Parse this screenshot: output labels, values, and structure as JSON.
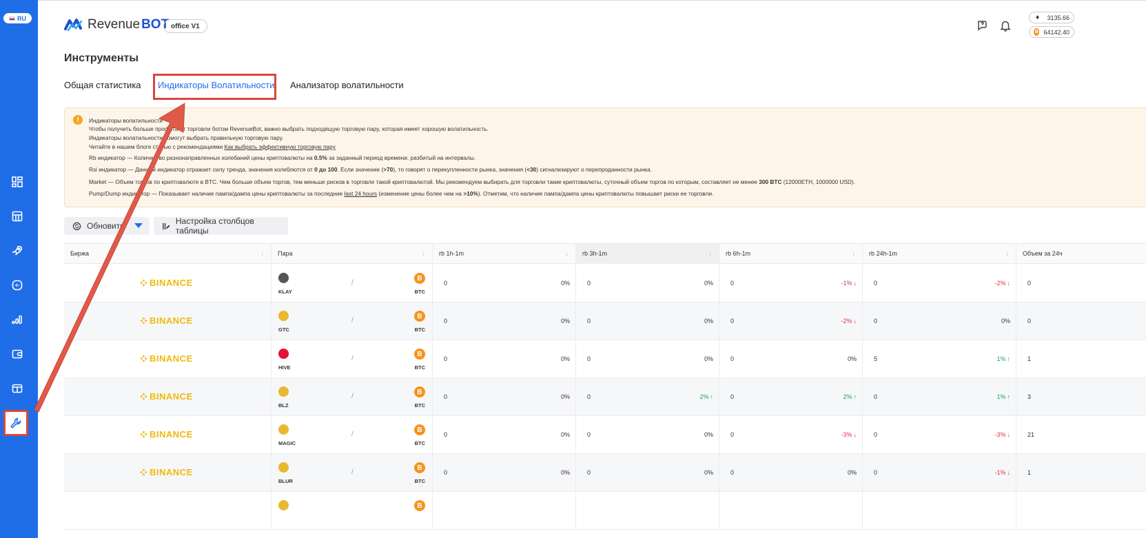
{
  "language": "RU",
  "logo": {
    "part1": "Revenue",
    "part2": "BOT"
  },
  "office_badge": "office V1",
  "balances": [
    {
      "coin_icon": "eth-icon",
      "value": "3135.66"
    },
    {
      "coin_icon": "btc-icon",
      "value": "64142.40"
    }
  ],
  "page_title": "Инструменты",
  "tabs": [
    {
      "label": "Общая статистика"
    },
    {
      "label": "Индикаторы Волатильности"
    },
    {
      "label": "Анализатор волатильности"
    }
  ],
  "notice": {
    "line1": "Индикаторы волатильности",
    "line2": "Чтобы получить больше профита от торговли ботом RevenueBot, важно выбрать подходящую торговую пару, которая имеет хорошую волатильность.",
    "line3": "Индикаторы волатильности помогут выбрать правильную торговую пару.",
    "line4_text": "Читайте в нашем блоге статью с рекомендациями ",
    "line4_link": "Как выбрать эффективную торговую пару",
    "rb_pre": "Rb индикатор — Количество разнонаправленных колебаний цены криптовалюты на ",
    "rb_bold": "0.5%",
    "rb_post": " за заданный период времени, разбитый на интервалы.",
    "rsi_pre": "Rsi индикатор — Данный индикатор отражает силу тренда, значения колеблются от ",
    "rsi_bold1": "0 до 100",
    "rsi_mid1": ". Если значение (",
    "rsi_bold2": ">70",
    "rsi_mid2": "), то говорят о перекупленности рынка, значения (",
    "rsi_bold3": "<30",
    "rsi_post": ") сигнализируют о перепроданности рынка.",
    "market_pre": "Market — Объем торгов по криптовалюте в BTC. Чем больше объем торгов, тем меньше рисков в торговле такой криптовалютой. Мы рекомендуем выбирать для торговли такие криптовалюты, суточный объем торгов по которым, составляет не менее ",
    "market_bold": "300 BTC",
    "market_post": " (12000ETH, 1000000 USD).",
    "pump_pre": "Pump/Dump индикатор — Показывает наличие пампа/дампа цены криптовалюты за последние ",
    "pump_link": "last 24 hours",
    "pump_mid": " (изменение цены более чем на ",
    "pump_bold": ">10%",
    "pump_post": "). Отметим, что наличие пампа/дампа цены криптовалюты повышает риски ее торговли."
  },
  "toolbar": {
    "refresh_label": "Обновить",
    "columns_label": "Настройка столбцов таблицы"
  },
  "table": {
    "columns": [
      "Биржа",
      "Пара",
      "rb 1h-1m",
      "rb 3h-1m",
      "rb 6h-1m",
      "rb 24h-1m",
      "Объем за 24ч"
    ],
    "quote_symbol": "BTC",
    "exchange": "BINANCE",
    "rows": [
      {
        "coin": "KLAY",
        "coin_color": "#555555",
        "rb1": "0",
        "rb1p": "0%",
        "rb1d": "",
        "rb3": "0",
        "rb3p": "0%",
        "rb3d": "",
        "rb6": "0",
        "rb6p": "-1%",
        "rb6d": "down",
        "rb24": "0",
        "rb24p": "-2%",
        "rb24d": "down",
        "vol": "0"
      },
      {
        "coin": "GTC",
        "coin_color": "#e8b830",
        "rb1": "0",
        "rb1p": "0%",
        "rb1d": "",
        "rb3": "0",
        "rb3p": "0%",
        "rb3d": "",
        "rb6": "0",
        "rb6p": "-2%",
        "rb6d": "down",
        "rb24": "0",
        "rb24p": "0%",
        "rb24d": "",
        "vol": "0"
      },
      {
        "coin": "HIVE",
        "coin_color": "#e31337",
        "rb1": "0",
        "rb1p": "0%",
        "rb1d": "",
        "rb3": "0",
        "rb3p": "0%",
        "rb3d": "",
        "rb6": "0",
        "rb6p": "0%",
        "rb6d": "",
        "rb24": "5",
        "rb24p": "1%",
        "rb24d": "up",
        "vol": "1"
      },
      {
        "coin": "BLZ",
        "coin_color": "#e8b830",
        "rb1": "0",
        "rb1p": "0%",
        "rb1d": "",
        "rb3": "0",
        "rb3p": "2%",
        "rb3d": "up",
        "rb6": "0",
        "rb6p": "2%",
        "rb6d": "up",
        "rb24": "0",
        "rb24p": "1%",
        "rb24d": "up",
        "vol": "3"
      },
      {
        "coin": "MAGIC",
        "coin_color": "#e8b830",
        "rb1": "0",
        "rb1p": "0%",
        "rb1d": "",
        "rb3": "0",
        "rb3p": "0%",
        "rb3d": "",
        "rb6": "0",
        "rb6p": "-3%",
        "rb6d": "down",
        "rb24": "0",
        "rb24p": "-3%",
        "rb24d": "down",
        "vol": "21"
      },
      {
        "coin": "BLUR",
        "coin_color": "#e8b830",
        "rb1": "0",
        "rb1p": "0%",
        "rb1d": "",
        "rb3": "0",
        "rb3p": "0%",
        "rb3d": "",
        "rb6": "0",
        "rb6p": "0%",
        "rb6d": "",
        "rb24": "0",
        "rb24p": "-1%",
        "rb24d": "down",
        "vol": "1"
      }
    ]
  },
  "colors": {
    "sidebar": "#1f6ee8",
    "accent": "#1f6ee8",
    "highlight": "#d9473a",
    "binance": "#f0b90b",
    "down": "#e0323a",
    "up": "#1aa55c"
  }
}
